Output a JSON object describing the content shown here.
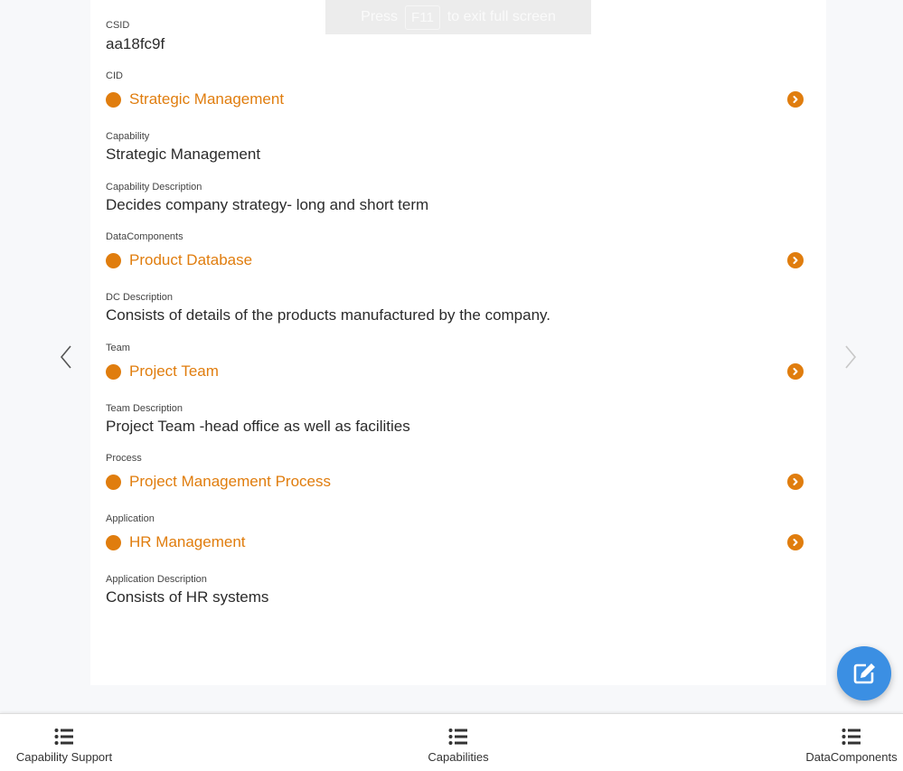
{
  "fullscreen_hint": {
    "press": "Press",
    "key": "F11",
    "rest": "to exit full screen"
  },
  "fields": {
    "csid": {
      "label": "CSID",
      "value": "aa18fc9f"
    },
    "cid": {
      "label": "CID",
      "value": "Strategic Management"
    },
    "capability": {
      "label": "Capability",
      "value": "Strategic Management"
    },
    "capability_description": {
      "label": "Capability Description",
      "value": "Decides company strategy- long and short term"
    },
    "data_components": {
      "label": "DataComponents",
      "value": "Product Database"
    },
    "dc_description": {
      "label": "DC Description",
      "value": "Consists of details of the products manufactured by the company."
    },
    "team": {
      "label": "Team",
      "value": "Project Team"
    },
    "team_description": {
      "label": "Team Description",
      "value": "Project Team -head office as well as facilities"
    },
    "process": {
      "label": "Process",
      "value": "Project Management Process"
    },
    "application": {
      "label": "Application",
      "value": "HR Management"
    },
    "application_description": {
      "label": "Application Description",
      "value": "Consists of HR systems"
    }
  },
  "bottom_nav": {
    "items": [
      {
        "label": "Capability Support",
        "icon": "list-icon"
      },
      {
        "label": "Capabilities",
        "icon": "list-icon"
      },
      {
        "label": "DataComponents",
        "icon": "list-icon"
      }
    ]
  },
  "colors": {
    "accent": "#e07d0e",
    "fab": "#3b8fe3",
    "background": "#f7f8fa"
  },
  "icons": {
    "prev": "chevron-left-icon",
    "next": "chevron-right-icon",
    "link": "chevron-circle-right-icon",
    "fab": "edit-icon"
  }
}
